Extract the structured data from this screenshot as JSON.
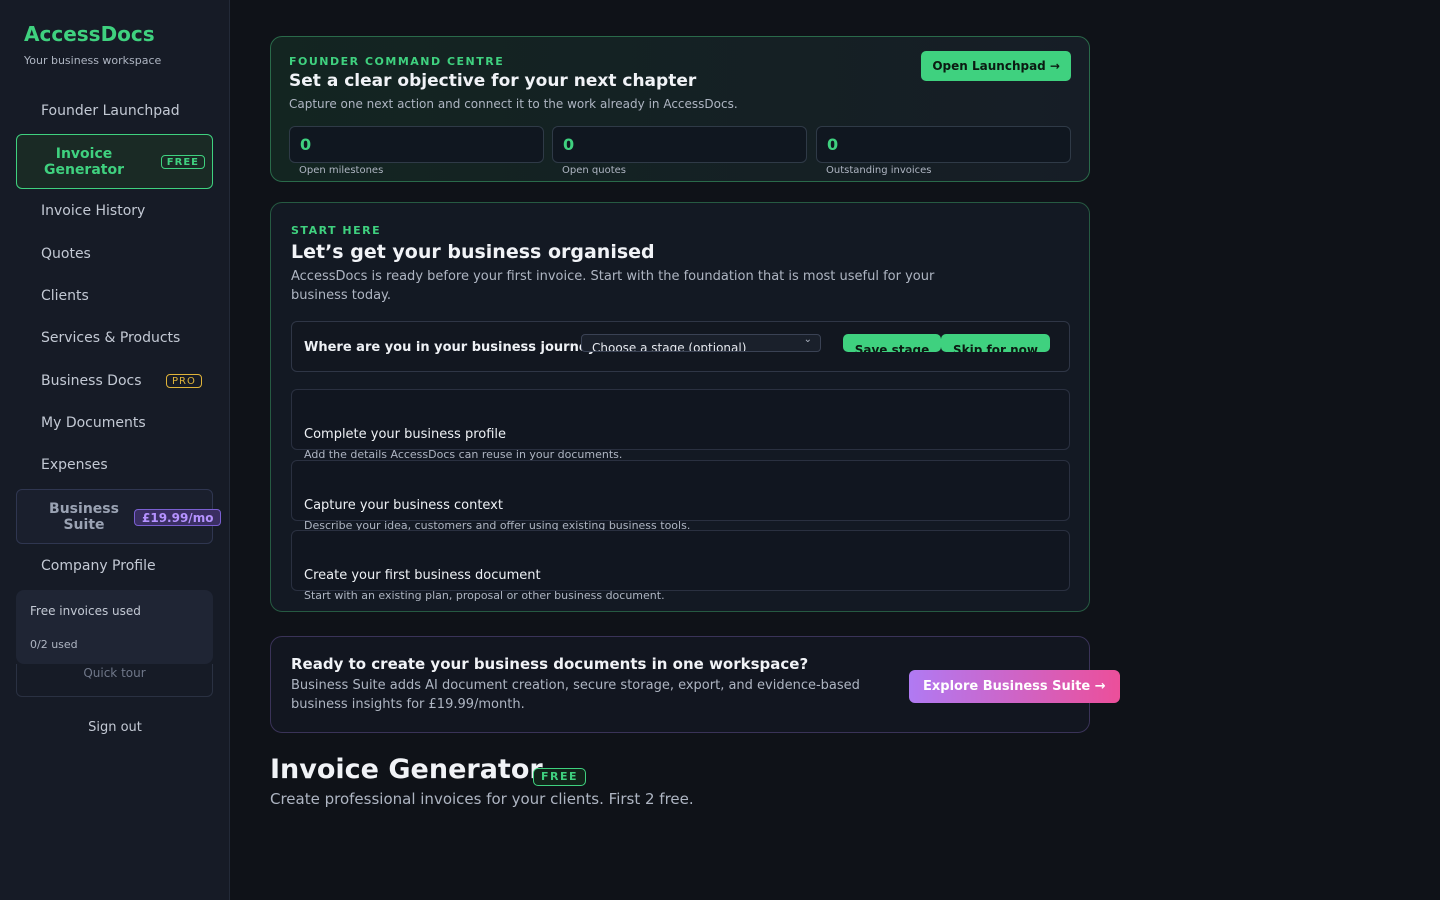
{
  "sidebar": {
    "brand": "AccessDocs",
    "brand_sub": "Your business workspace",
    "items": [
      {
        "label": "Founder Launchpad"
      },
      {
        "label": "Invoice Generator",
        "badge": "FREE"
      },
      {
        "label": "Invoice History"
      },
      {
        "label": "Quotes"
      },
      {
        "label": "Clients"
      },
      {
        "label": "Services & Products"
      },
      {
        "label": "Business Docs",
        "badge": "PRO"
      },
      {
        "label": "My Documents"
      },
      {
        "label": "Expenses"
      },
      {
        "label": "Business Suite",
        "badge": "£19.99/mo"
      },
      {
        "label": "Company Profile"
      }
    ],
    "usage": {
      "title": "Free invoices used",
      "count": "0/2 used"
    },
    "quick_tour": "Quick tour",
    "sign_out": "Sign out"
  },
  "founder": {
    "eyebrow": "FOUNDER COMMAND CENTRE",
    "title": "Set a clear objective for your next chapter",
    "desc": "Capture one next action and connect it to the work already in AccessDocs.",
    "button": "Open Launchpad →",
    "stats": [
      {
        "value": "0",
        "label": "Open milestones"
      },
      {
        "value": "0",
        "label": "Open quotes"
      },
      {
        "value": "0",
        "label": "Outstanding invoices"
      }
    ]
  },
  "start": {
    "eyebrow": "START HERE",
    "title": "Let’s get your business organised",
    "desc": "AccessDocs is ready before your first invoice. Start with the foundation that is most useful for your business today.",
    "journey_label": "Where are you in your business journey?",
    "stage_select": "Choose a stage (optional)",
    "save_stage": "Save stage",
    "skip": "Skip for now",
    "tasks": [
      {
        "title": "Complete your business profile",
        "sub": "Add the details AccessDocs can reuse in your documents."
      },
      {
        "title": "Capture your business context",
        "sub": "Describe your idea, customers and offer using existing business tools."
      },
      {
        "title": "Create your first business document",
        "sub": "Start with an existing plan, proposal or other business document."
      }
    ]
  },
  "suite": {
    "title": "Ready to create your business documents in one workspace?",
    "desc": "Business Suite adds AI document creation, secure storage, export, and evidence-based business insights for £19.99/month.",
    "button": "Explore Business Suite →"
  },
  "page": {
    "title": "Invoice Generator",
    "badge": "FREE",
    "subtitle": "Create professional invoices for your clients. First 2 free."
  },
  "colors": {
    "accent": "#3fd17f",
    "background": "#0f1218",
    "sidebar": "#161b26",
    "pro": "#e0b43a",
    "suite": "#b592ff"
  }
}
